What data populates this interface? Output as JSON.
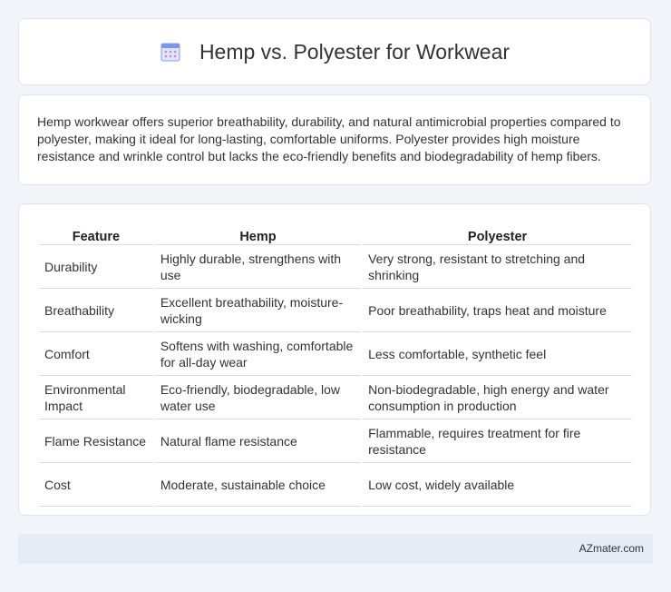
{
  "header": {
    "title": "Hemp vs. Polyester for Workwear",
    "icon": "calendar-icon"
  },
  "summary": "Hemp workwear offers superior breathability, durability, and natural antimicrobial properties compared to polyester, making it ideal for long-lasting, comfortable uniforms. Polyester provides high moisture resistance and wrinkle control but lacks the eco-friendly benefits and biodegradability of hemp fibers.",
  "table": {
    "headers": [
      "Feature",
      "Hemp",
      "Polyester"
    ],
    "rows": [
      [
        "Durability",
        "Highly durable, strengthens with use",
        "Very strong, resistant to stretching and shrinking"
      ],
      [
        "Breathability",
        "Excellent breathability, moisture-wicking",
        "Poor breathability, traps heat and moisture"
      ],
      [
        "Comfort",
        "Softens with washing, comfortable for all-day wear",
        "Less comfortable, synthetic feel"
      ],
      [
        "Environmental Impact",
        "Eco-friendly, biodegradable, low water use",
        "Non-biodegradable, high energy and water consumption in production"
      ],
      [
        "Flame Resistance",
        "Natural flame resistance",
        "Flammable, requires treatment for fire resistance"
      ],
      [
        "Cost",
        "Moderate, sustainable choice",
        "Low cost, widely available"
      ]
    ]
  },
  "footer": {
    "text": "AZmater.com"
  }
}
